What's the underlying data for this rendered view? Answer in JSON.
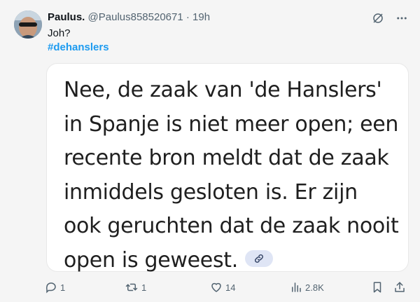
{
  "tweet": {
    "author_name": "Paulus.",
    "author_handle": "@Paulus858520671",
    "separator": "·",
    "time": "19h",
    "text": "Joh?",
    "hashtag": "#dehanslers"
  },
  "card": {
    "text": "Nee, de zaak van 'de Hanslers' in Spanje is niet meer open; een recente bron meldt dat de zaak inmiddels gesloten is. Er zijn ook geruchten dat de zaak nooit open is geweest.",
    "link_icon": "link-icon"
  },
  "actions": {
    "reply_count": "1",
    "retweet_count": "1",
    "like_count": "14",
    "views_count": "2.8K"
  },
  "icons": {
    "grok": "grok-slash-icon",
    "more": "more-dots-icon",
    "reply": "reply-bubble-icon",
    "retweet": "retweet-icon",
    "like": "heart-icon",
    "views": "bar-chart-icon",
    "bookmark": "bookmark-icon",
    "share": "share-icon"
  },
  "colors": {
    "link": "#1d9bf0",
    "secondary": "#536471",
    "card_bg": "#ffffff",
    "page_bg": "#f5f5f5"
  }
}
